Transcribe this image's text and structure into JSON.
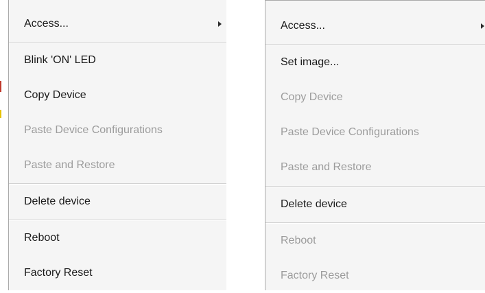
{
  "left_menu": {
    "items": [
      {
        "label": "Access...",
        "enabled": true,
        "has_submenu": true
      },
      {
        "label": "Blink 'ON' LED",
        "enabled": true,
        "has_submenu": false
      },
      {
        "label": "Copy Device",
        "enabled": true,
        "has_submenu": false
      },
      {
        "label": "Paste Device Configurations",
        "enabled": false,
        "has_submenu": false
      },
      {
        "label": "Paste and Restore",
        "enabled": false,
        "has_submenu": false
      },
      {
        "label": "Delete device",
        "enabled": true,
        "has_submenu": false
      },
      {
        "label": "Reboot",
        "enabled": true,
        "has_submenu": false
      },
      {
        "label": "Factory Reset",
        "enabled": true,
        "has_submenu": false
      }
    ]
  },
  "right_menu": {
    "items": [
      {
        "label": "Access...",
        "enabled": true,
        "has_submenu": true
      },
      {
        "label": "Set image...",
        "enabled": true,
        "has_submenu": false
      },
      {
        "label": "Copy Device",
        "enabled": false,
        "has_submenu": false
      },
      {
        "label": "Paste Device Configurations",
        "enabled": false,
        "has_submenu": false
      },
      {
        "label": "Paste and Restore",
        "enabled": false,
        "has_submenu": false
      },
      {
        "label": "Delete device",
        "enabled": true,
        "has_submenu": false
      },
      {
        "label": "Reboot",
        "enabled": false,
        "has_submenu": false
      },
      {
        "label": "Factory Reset",
        "enabled": false,
        "has_submenu": false
      }
    ]
  },
  "colors": {
    "menu_background": "#f5f5f5",
    "enabled_text": "#1a1a1a",
    "disabled_text": "#9c9c9c",
    "separator": "#d2d2d2",
    "border": "#a9a9a9",
    "background_window_accent_red": "#c0392b",
    "background_window_accent_yellow": "#e6c200"
  },
  "icons": {
    "submenu_indicator": "triangle-right-icon"
  }
}
